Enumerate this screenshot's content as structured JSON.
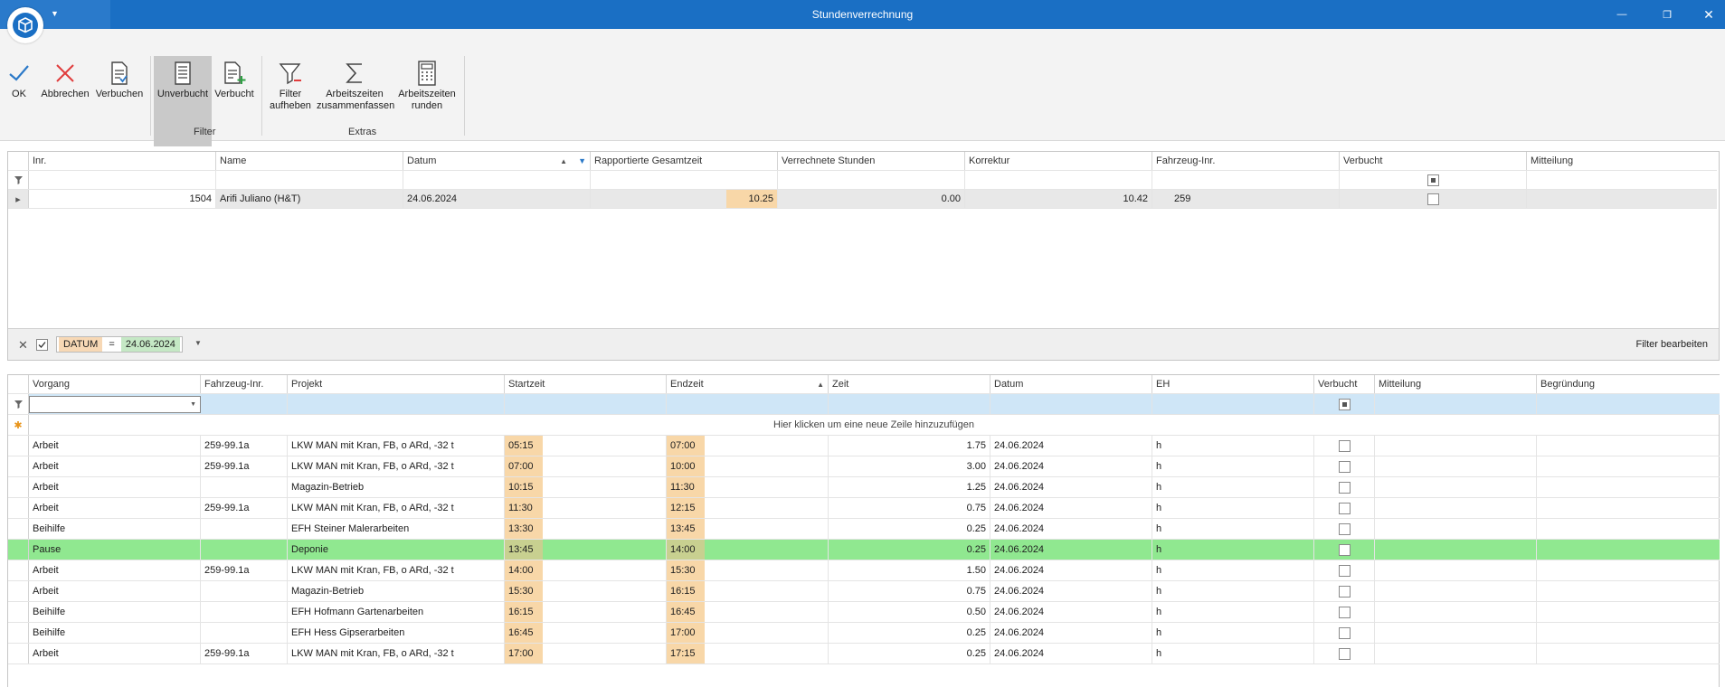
{
  "window": {
    "title": "Stundenverrechnung",
    "minimize_glyph": "—",
    "restore_glyph": "❐",
    "close_glyph": "✕"
  },
  "ribbon": {
    "buttons": {
      "ok": "OK",
      "cancel": "Abbrechen",
      "book": "Verbuchen",
      "unbooked_filter": "Unverbucht",
      "booked_filter": "Verbucht",
      "clear_filter_1": "Filter",
      "clear_filter_2": "aufheben",
      "merge_1": "Arbeitszeiten",
      "merge_2": "zusammenfassen",
      "round_1": "Arbeitszeiten",
      "round_2": "runden"
    },
    "groups": {
      "filter": "Filter",
      "extras": "Extras"
    }
  },
  "top_grid": {
    "columns": [
      "Inr.",
      "Name",
      "Datum",
      "Rapportierte Gesamtzeit",
      "Verrechnete Stunden",
      "Korrektur",
      "Fahrzeug-Inr.",
      "Verbucht",
      "Mitteilung"
    ],
    "row": {
      "inr": "1504",
      "name": "Arifi Juliano (H&T)",
      "datum": "24.06.2024",
      "gesamtzeit": "10.25",
      "verrechnet": "0.00",
      "korrektur": "10.42",
      "fahrzeug": "259"
    },
    "filter_panel": {
      "field": "DATUM",
      "operator": "=",
      "value": "24.06.2024",
      "edit_label": "Filter bearbeiten"
    }
  },
  "bottom_grid": {
    "columns": [
      "Vorgang",
      "Fahrzeug-Inr.",
      "Projekt",
      "Startzeit",
      "Endzeit",
      "Zeit",
      "Datum",
      "EH",
      "Verbucht",
      "Mitteilung",
      "Begründung"
    ],
    "new_row_hint": "Hier klicken um eine neue Zeile hinzuzufügen",
    "rows": [
      {
        "vorgang": "Arbeit",
        "fahrzeug": "259-99.1a",
        "projekt": "LKW MAN mit Kran, FB, o ARd, -32 t",
        "start": "05:15",
        "ende": "07:00",
        "zeit": "1.75",
        "datum": "24.06.2024",
        "eh": "h"
      },
      {
        "vorgang": "Arbeit",
        "fahrzeug": "259-99.1a",
        "projekt": "LKW MAN mit Kran, FB, o ARd, -32 t",
        "start": "07:00",
        "ende": "10:00",
        "zeit": "3.00",
        "datum": "24.06.2024",
        "eh": "h"
      },
      {
        "vorgang": "Arbeit",
        "fahrzeug": "",
        "projekt": "Magazin-Betrieb",
        "start": "10:15",
        "ende": "11:30",
        "zeit": "1.25",
        "datum": "24.06.2024",
        "eh": "h"
      },
      {
        "vorgang": "Arbeit",
        "fahrzeug": "259-99.1a",
        "projekt": "LKW MAN mit Kran, FB, o ARd, -32 t",
        "start": "11:30",
        "ende": "12:15",
        "zeit": "0.75",
        "datum": "24.06.2024",
        "eh": "h"
      },
      {
        "vorgang": "Beihilfe",
        "fahrzeug": "",
        "projekt": "EFH Steiner Malerarbeiten",
        "start": "13:30",
        "ende": "13:45",
        "zeit": "0.25",
        "datum": "24.06.2024",
        "eh": "h"
      },
      {
        "vorgang": "Pause",
        "fahrzeug": "",
        "projekt": "Deponie",
        "start": "13:45",
        "ende": "14:00",
        "zeit": "0.25",
        "datum": "24.06.2024",
        "eh": "h"
      },
      {
        "vorgang": "Arbeit",
        "fahrzeug": "259-99.1a",
        "projekt": "LKW MAN mit Kran, FB, o ARd, -32 t",
        "start": "14:00",
        "ende": "15:30",
        "zeit": "1.50",
        "datum": "24.06.2024",
        "eh": "h"
      },
      {
        "vorgang": "Arbeit",
        "fahrzeug": "",
        "projekt": "Magazin-Betrieb",
        "start": "15:30",
        "ende": "16:15",
        "zeit": "0.75",
        "datum": "24.06.2024",
        "eh": "h"
      },
      {
        "vorgang": "Beihilfe",
        "fahrzeug": "",
        "projekt": "EFH Hofmann Gartenarbeiten",
        "start": "16:15",
        "ende": "16:45",
        "zeit": "0.50",
        "datum": "24.06.2024",
        "eh": "h"
      },
      {
        "vorgang": "Beihilfe",
        "fahrzeug": "",
        "projekt": "EFH Hess Gipserarbeiten",
        "start": "16:45",
        "ende": "17:00",
        "zeit": "0.25",
        "datum": "24.06.2024",
        "eh": "h"
      },
      {
        "vorgang": "Arbeit",
        "fahrzeug": "259-99.1a",
        "projekt": "LKW MAN mit Kran, FB, o ARd, -32 t",
        "start": "17:00",
        "ende": "17:15",
        "zeit": "0.25",
        "datum": "24.06.2024",
        "eh": "h"
      }
    ]
  },
  "colors": {
    "titlebar": "#1a6fc4",
    "time_highlight": "#f8d7a8",
    "pause_row": "#90e890",
    "filter_row": "#cfe6f7"
  }
}
